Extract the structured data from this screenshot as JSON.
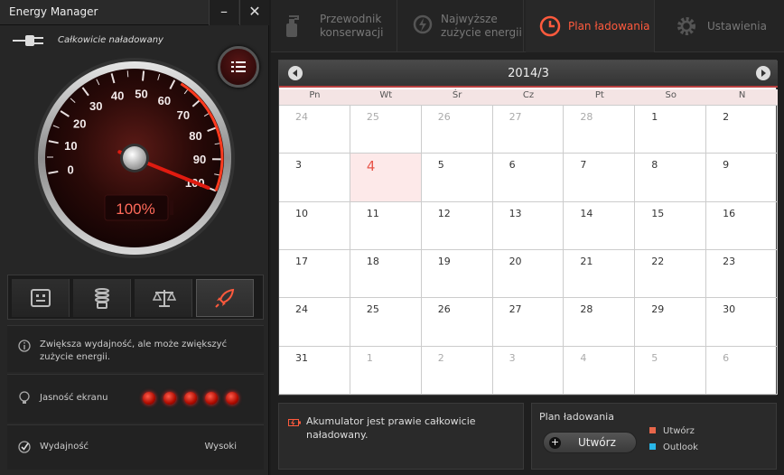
{
  "window": {
    "title": "Energy Manager",
    "minimize_label": "–",
    "close_label": "✕"
  },
  "status": {
    "text": "Całkowicie naładowany"
  },
  "gauge": {
    "ticks": [
      "0",
      "10",
      "20",
      "30",
      "40",
      "50",
      "60",
      "70",
      "80",
      "90",
      "100"
    ],
    "readout": "100%",
    "value": 100
  },
  "modes": [
    {
      "name": "battery-saver",
      "icon": "robot-face-icon"
    },
    {
      "name": "spring",
      "icon": "spring-icon"
    },
    {
      "name": "balanced",
      "icon": "scale-icon"
    },
    {
      "name": "performance",
      "icon": "rocket-icon",
      "active": true
    }
  ],
  "description": "Zwiększa wydajność, ale może zwiększyć zużycie energii.",
  "brightness": {
    "label": "Jasność ekranu",
    "level": 5,
    "max": 5
  },
  "performance": {
    "label": "Wydajność",
    "value": "Wysoki"
  },
  "nav": {
    "tabs": [
      {
        "line1": "Przewodnik",
        "line2": "konserwacji"
      },
      {
        "line1": "Najwyższe",
        "line2": "zużycie energii"
      },
      {
        "line1": "Plan ładowania",
        "line2": ""
      },
      {
        "line1": "Ustawienia",
        "line2": ""
      }
    ]
  },
  "calendar": {
    "title": "2014/3",
    "weekdays": [
      "Pn",
      "Wt",
      "Śr",
      "Cz",
      "Pt",
      "So",
      "N"
    ],
    "weeks": [
      [
        "24",
        "25",
        "26",
        "27",
        "28",
        "1",
        "2"
      ],
      [
        "3",
        "4",
        "5",
        "6",
        "7",
        "8",
        "9"
      ],
      [
        "10",
        "11",
        "12",
        "13",
        "14",
        "15",
        "16"
      ],
      [
        "17",
        "18",
        "19",
        "20",
        "21",
        "22",
        "23"
      ],
      [
        "24",
        "25",
        "26",
        "27",
        "28",
        "29",
        "30"
      ],
      [
        "31",
        "1",
        "2",
        "3",
        "4",
        "5",
        "6"
      ]
    ],
    "today": "4"
  },
  "battery_message": "Akumulator jest prawie całkowicie naładowany.",
  "plan": {
    "title": "Plan ładowania",
    "create_button": "Utwórz",
    "legend": [
      {
        "label": "Utwórz",
        "color": "#e8664a"
      },
      {
        "label": "Outlook",
        "color": "#29b6e8"
      }
    ]
  },
  "colors": {
    "accent": "#ff5a3d",
    "led": "#e01b10"
  }
}
